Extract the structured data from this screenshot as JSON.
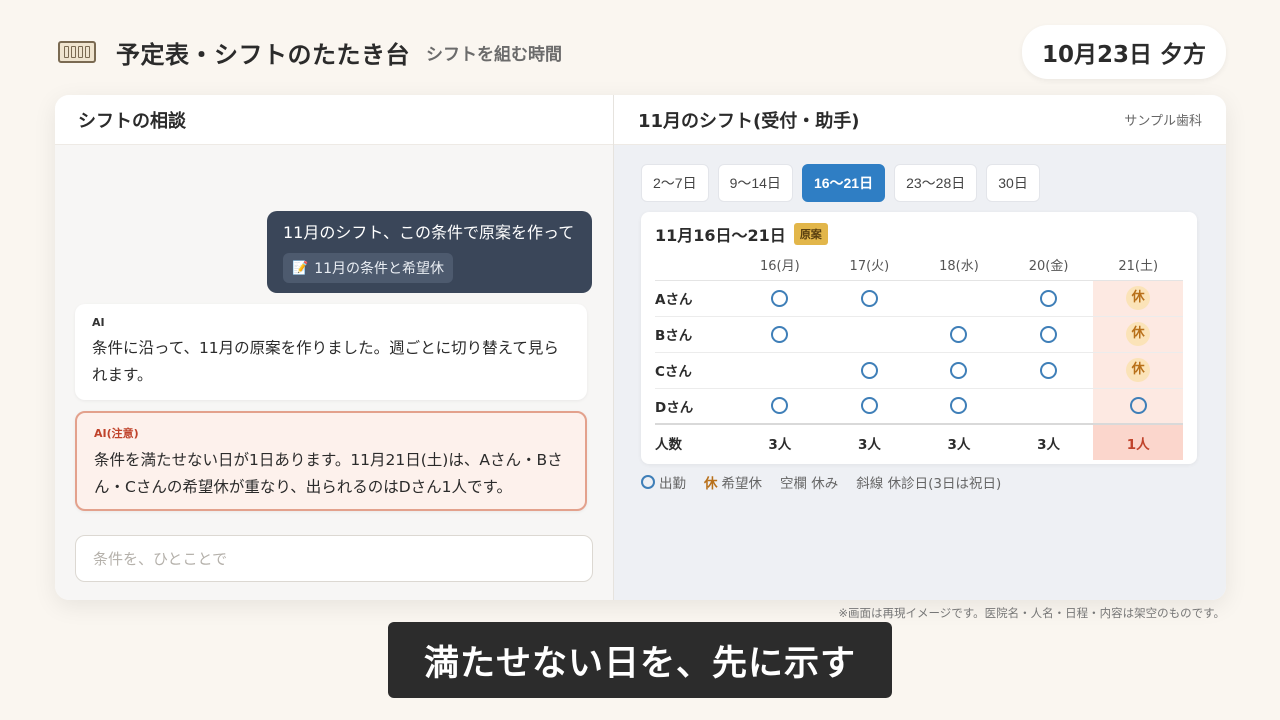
{
  "header": {
    "title": "予定表・シフトのたたき台",
    "subtitle": "シフトを組む時間",
    "date": "10月23日 夕方"
  },
  "chat": {
    "title": "シフトの相談",
    "user_message": "11月のシフト、この条件で原案を作って",
    "attachment": "11月の条件と希望休",
    "ai_info": {
      "label": "AI",
      "text": "条件に沿って、11月の原案を作りました。週ごとに切り替えて見られます。"
    },
    "ai_warning": {
      "label": "AI(注意)",
      "text": "条件を満たせない日が1日あります。11月21日(土)は、Aさん・Bさん・Cさんの希望休が重なり、出られるのはDさん1人です。"
    },
    "composer_placeholder": "条件を、ひとことで"
  },
  "shift": {
    "title": "11月のシフト(受付・助手)",
    "clinic": "サンプル歯科",
    "tabs": [
      "2〜7日",
      "9〜14日",
      "16〜21日",
      "23〜28日",
      "30日"
    ],
    "active_tab": 2,
    "range": "11月16日〜21日",
    "draft_badge": "原案",
    "days": [
      "16(月)",
      "17(火)",
      "18(水)",
      "20(金)",
      "21(土)"
    ],
    "rows": [
      {
        "name": "Aさん",
        "cells": [
          "on",
          "on",
          "",
          "on",
          "rest"
        ]
      },
      {
        "name": "Bさん",
        "cells": [
          "on",
          "",
          "on",
          "on",
          "rest"
        ]
      },
      {
        "name": "Cさん",
        "cells": [
          "",
          "on",
          "on",
          "on",
          "rest"
        ]
      },
      {
        "name": "Dさん",
        "cells": [
          "on",
          "on",
          "on",
          "",
          "on"
        ]
      }
    ],
    "total_label": "人数",
    "totals": [
      "3人",
      "3人",
      "3人",
      "3人",
      "1人"
    ],
    "rest_symbol": "休",
    "legend": {
      "on": "出勤",
      "rest_symbol": "休",
      "rest": "希望休",
      "blank": "空欄 休み",
      "hatched": "斜線 休診日(3日は祝日)"
    }
  },
  "footer": {
    "disclaimer": "※画面は再現イメージです。医院名・人名・日程・内容は架空のものです。",
    "caption": "満たせない日を、先に示す"
  },
  "colors": {
    "accent": "#2f7ec4",
    "warning": "#c0432b",
    "rest": "#b8701a",
    "user_bubble": "#3a4659"
  }
}
